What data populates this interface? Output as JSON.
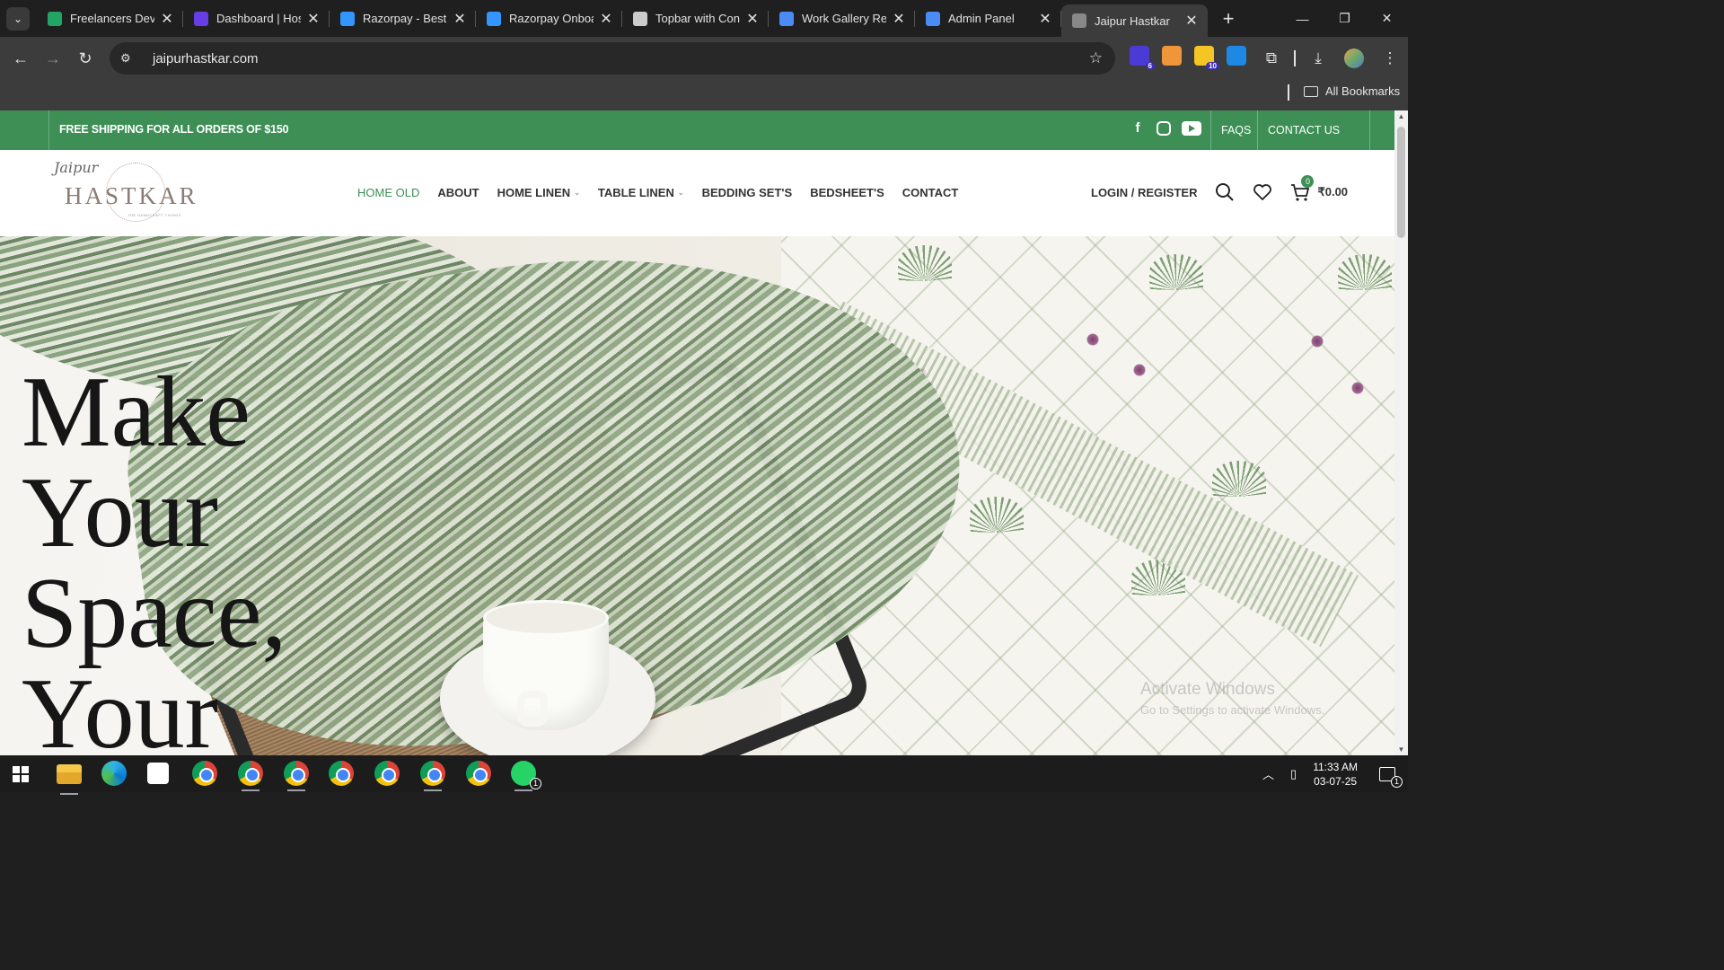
{
  "browser": {
    "tabs": [
      {
        "title": "Freelancers Deve",
        "favicon": "google-sheets-icon",
        "color": "#21a464",
        "active": false
      },
      {
        "title": "Dashboard | Hos",
        "favicon": "hostinger-icon",
        "color": "#673de6",
        "active": false
      },
      {
        "title": "Razorpay - Best",
        "favicon": "razorpay-icon",
        "color": "#3395ff",
        "active": false
      },
      {
        "title": "Razorpay Onboa",
        "favicon": "razorpay-icon",
        "color": "#3395ff",
        "active": false
      },
      {
        "title": "Topbar with Con",
        "favicon": "openai-icon",
        "color": "#cccccc",
        "active": false
      },
      {
        "title": "Work Gallery Re",
        "favicon": "gemini-icon",
        "color": "#4b8bf5",
        "active": false
      },
      {
        "title": "Admin Panel",
        "favicon": "gemini-icon",
        "color": "#4b8bf5",
        "active": false
      },
      {
        "title": "Jaipur Hastkar",
        "favicon": "loading-icon",
        "color": "#888888",
        "active": true
      }
    ],
    "url": "jaipurhastkar.com",
    "extensions": [
      {
        "name": "ext-purple-icon",
        "color": "#4b3bd6",
        "badge": "6"
      },
      {
        "name": "ext-orange-icon",
        "color": "#f0953a",
        "badge": ""
      },
      {
        "name": "ext-yellow-icon",
        "color": "#f3c623",
        "badge": "10"
      },
      {
        "name": "ext-m-icon",
        "color": "#1e88e5",
        "badge": ""
      }
    ],
    "bookmarks_label": "All Bookmarks"
  },
  "site": {
    "promo_text": "FREE SHIPPING FOR ALL ORDERS OF $150",
    "faqs": "FAQS",
    "contact_us": "CONTACT US",
    "logo": {
      "script": "Jaipur",
      "word": "HASTKAR",
      "tagline": "THE HANDCRAFT THINGS"
    },
    "nav": [
      {
        "label": "HOME OLD",
        "active": true,
        "dropdown": false
      },
      {
        "label": "ABOUT",
        "active": false,
        "dropdown": false
      },
      {
        "label": "HOME LINEN",
        "active": false,
        "dropdown": true
      },
      {
        "label": "TABLE LINEN",
        "active": false,
        "dropdown": true
      },
      {
        "label": "BEDDING SET'S",
        "active": false,
        "dropdown": false
      },
      {
        "label": "BEDSHEET'S",
        "active": false,
        "dropdown": false
      },
      {
        "label": "CONTACT",
        "active": false,
        "dropdown": false
      }
    ],
    "login": "LOGIN / REGISTER",
    "cart_count": "0",
    "cart_total": "₹0.00",
    "hero_lines": [
      "Make",
      "Your",
      "Space,",
      "Your"
    ],
    "accent": "#3d8f56"
  },
  "watermark": {
    "line1": "Activate Windows",
    "line2": "Go to Settings to activate Windows."
  },
  "taskbar": {
    "time": "11:33 AM",
    "date": "03-07-25",
    "notifications": "1",
    "whatsapp_badge": "1"
  }
}
